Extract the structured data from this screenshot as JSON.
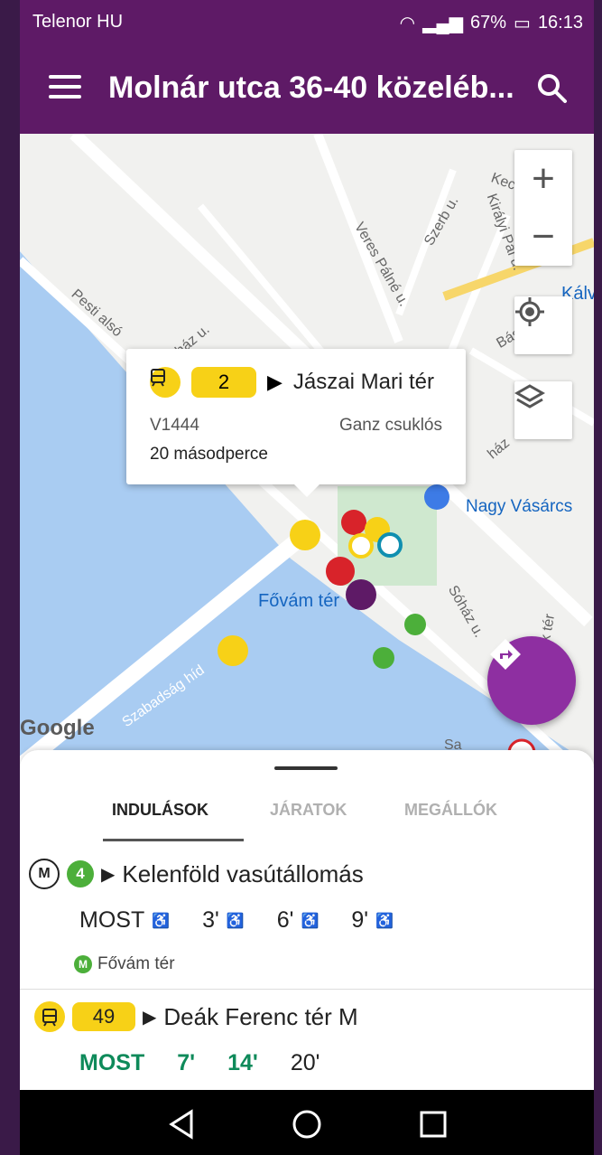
{
  "status": {
    "carrier": "Telenor HU",
    "battery": "67%",
    "time": "16:13"
  },
  "appbar": {
    "title": "Molnár utca 36-40 közeléb..."
  },
  "map": {
    "labels": [
      "Veres Pálné u.",
      "Szerb u.",
      "Királyi Pál u.",
      "Kecskeméti",
      "Kálv",
      "Pesti alsó",
      "ház u.",
      "Bás",
      "Nagy Vásárcs",
      "Fővám tér",
      "Sóház u.",
      "Szabadság híd",
      "ház",
      "k tér",
      "Sa"
    ],
    "zoom_in": "+",
    "zoom_out": "−",
    "google": "Google"
  },
  "callout": {
    "route": "2",
    "destination": "Jászai Mari tér",
    "vehicle_id": "V1444",
    "vehicle_type": "Ganz csuklós",
    "eta": "20 másodperce"
  },
  "tabs": [
    {
      "label": "INDULÁSOK",
      "active": true
    },
    {
      "label": "JÁRATOK",
      "active": false
    },
    {
      "label": "MEGÁLLÓK",
      "active": false
    }
  ],
  "departures": [
    {
      "line_badge": "M",
      "route": "4",
      "destination": "Kelenföld vasútállomás",
      "times": [
        "MOST",
        "3'",
        "6'",
        "9'"
      ],
      "stop_badge": "M",
      "stop": "Fővám tér"
    },
    {
      "route": "49",
      "destination": "Deák Ferenc tér M",
      "times": [
        "MOST",
        "7'",
        "14'",
        "20'"
      ]
    }
  ],
  "colors": {
    "header": "#5e1a66",
    "tram": "#f7d117",
    "metro_green": "#4caf3a",
    "fab": "#8e2fa1",
    "realtime": "#0e8a5a"
  }
}
